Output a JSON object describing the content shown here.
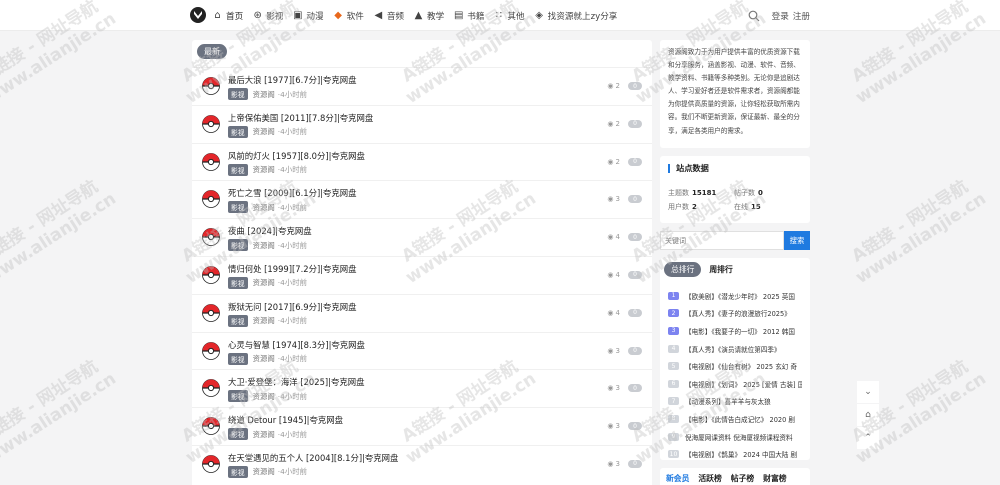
{
  "nav": {
    "items": [
      {
        "label": "首页",
        "icon": "home-icon"
      },
      {
        "label": "影视",
        "icon": "film-reel-icon"
      },
      {
        "label": "动漫",
        "icon": "tv-icon"
      },
      {
        "label": "软件",
        "icon": "fox-icon"
      },
      {
        "label": "音频",
        "icon": "speaker-icon"
      },
      {
        "label": "教学",
        "icon": "graduation-cap-icon"
      },
      {
        "label": "书籍",
        "icon": "book-icon"
      },
      {
        "label": "其他",
        "icon": "grid-icon"
      },
      {
        "label": "找资源就上zy分享",
        "icon": "box-icon"
      }
    ],
    "login_label": "登录",
    "register_label": "注册"
  },
  "main": {
    "latest_label": "最新",
    "posts": [
      {
        "title": "最后大浪 [1977][6.7分]|夸克网盘",
        "category": "影视",
        "author": "资源阁",
        "time": "4小时前",
        "views": "2",
        "comments": "0"
      },
      {
        "title": "上帝保佑美国 [2011][7.8分]|夸克网盘",
        "category": "影视",
        "author": "资源阁",
        "time": "4小时前",
        "views": "2",
        "comments": "0"
      },
      {
        "title": "风前的灯火 [1957][8.0分]|夸克网盘",
        "category": "影视",
        "author": "资源阁",
        "time": "4小时前",
        "views": "2",
        "comments": "0"
      },
      {
        "title": "死亡之雪 [2009][6.1分]|夸克网盘",
        "category": "影视",
        "author": "资源阁",
        "time": "4小时前",
        "views": "3",
        "comments": "0"
      },
      {
        "title": "夜曲 [2024]|夸克网盘",
        "category": "影视",
        "author": "资源阁",
        "time": "4小时前",
        "views": "4",
        "comments": "0"
      },
      {
        "title": "情归何处 [1999][7.2分]|夸克网盘",
        "category": "影视",
        "author": "资源阁",
        "time": "4小时前",
        "views": "4",
        "comments": "0"
      },
      {
        "title": "叛狱无问 [2017][6.9分]|夸克网盘",
        "category": "影视",
        "author": "资源阁",
        "time": "4小时前",
        "views": "4",
        "comments": "0"
      },
      {
        "title": "心灵与智慧 [1974][8.3分]|夸克网盘",
        "category": "影视",
        "author": "资源阁",
        "time": "4小时前",
        "views": "3",
        "comments": "0"
      },
      {
        "title": "大卫·爱登堡：海洋 [2025]|夸克网盘",
        "category": "影视",
        "author": "资源阁",
        "time": "4小时前",
        "views": "3",
        "comments": "0"
      },
      {
        "title": "绕道 Detour [1945]|夸克网盘",
        "category": "影视",
        "author": "资源阁",
        "time": "4小时前",
        "views": "3",
        "comments": "0"
      },
      {
        "title": "在天堂遇见的五个人 [2004][8.1分]|夸克网盘",
        "category": "影视",
        "author": "资源阁",
        "time": "4小时前",
        "views": "3",
        "comments": "0"
      }
    ]
  },
  "sidebar": {
    "intro_text": "资源阁致力于为用户提供丰富的优质资源下载和分享服务，涵盖影视、动漫、软件、音频、教学资料、书籍等多种类别。无论你是追剧达人、学习爱好者还是软件需求者，资源阁都能为你提供高质量的资源，让你轻松获取所需内容。我们不断更新资源，保证最新、最全的分享，满足各类用户的需求。",
    "stats_title": "站点数据",
    "stats": [
      {
        "label": "主题数",
        "value": "15181"
      },
      {
        "label": "帖子数",
        "value": "0"
      },
      {
        "label": "用户数",
        "value": "2"
      },
      {
        "label": "在线",
        "value": "15"
      }
    ],
    "search_placeholder": "关键词",
    "search_button": "搜索",
    "rank_tabs": {
      "active": "总排行",
      "other": "周排行"
    },
    "rank_items": [
      {
        "num": "1",
        "text": "【欧美剧】《潜龙少年时》 2025 英国"
      },
      {
        "num": "2",
        "text": "【真人秀】《妻子的浪漫旅行2025》"
      },
      {
        "num": "3",
        "text": "【电影】《我要子的一切》 2012 韩国"
      },
      {
        "num": "4",
        "text": "【真人秀】《演员请就位第四季》"
      },
      {
        "num": "5",
        "text": "【电视剧】《仙台有树》 2025 玄幻 奇"
      },
      {
        "num": "6",
        "text": "【电视剧】《划词》 2025 [爱情 古装] 国"
      },
      {
        "num": "7",
        "text": "【动漫系列】喜羊羊与灰太狼"
      },
      {
        "num": "8",
        "text": "【电影】《此情告白成记忆》 2020 剧"
      },
      {
        "num": "9",
        "text": "倪海厦网课资料 倪海厦视频课程资料"
      },
      {
        "num": "10",
        "text": "【电视剧】《鹊巢》 2024 中国大陆 剧"
      }
    ],
    "member_tabs": [
      "新会员",
      "活跃榜",
      "帖子榜",
      "财富榜"
    ]
  },
  "watermark": {
    "line1": "A链接 - 网址导航",
    "line2": "www.alianjie.cn"
  }
}
